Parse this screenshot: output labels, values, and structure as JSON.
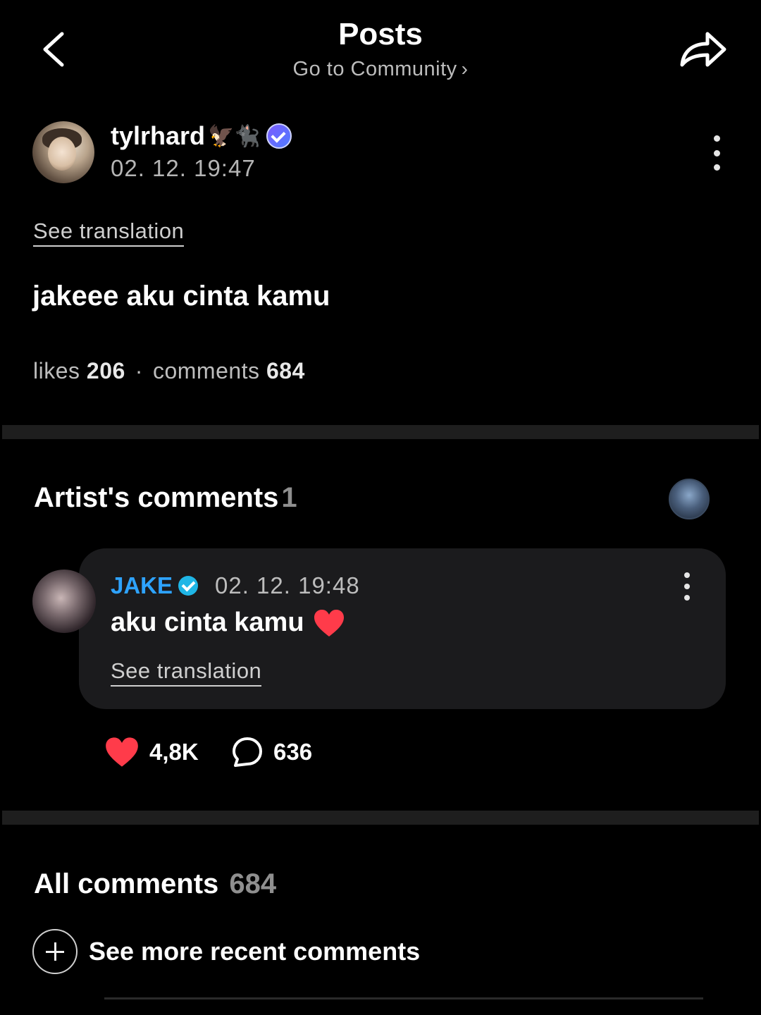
{
  "header": {
    "title": "Posts",
    "community_link": "Go to Community",
    "back_icon": "chevron-left-icon",
    "share_icon": "share-arrow-icon"
  },
  "post": {
    "author": {
      "name": "tylrhard",
      "name_emojis": "🦅🐈‍⬛",
      "verified": true
    },
    "timestamp": "02. 12. 19:47",
    "see_translation": "See translation",
    "body": "jakeee aku cinta kamu",
    "stats": {
      "likes_label": "likes",
      "likes_count": "206",
      "separator": "·",
      "comments_label": "comments",
      "comments_count": "684"
    }
  },
  "artist_comments": {
    "title": "Artist's comments",
    "count": "1",
    "comment": {
      "author": "JAKE",
      "verified": true,
      "timestamp": "02. 12. 19:48",
      "text": "aku cinta kamu",
      "see_translation": "See translation",
      "likes": "4,8K",
      "replies": "636"
    }
  },
  "all_comments": {
    "title": "All comments",
    "count": "684",
    "see_more": "See more recent comments"
  },
  "colors": {
    "background": "#000000",
    "artist_name": "#2ea3ff",
    "heart": "#ff3b4a",
    "card": "#1b1b1d",
    "divider": "#1e1e1e"
  }
}
